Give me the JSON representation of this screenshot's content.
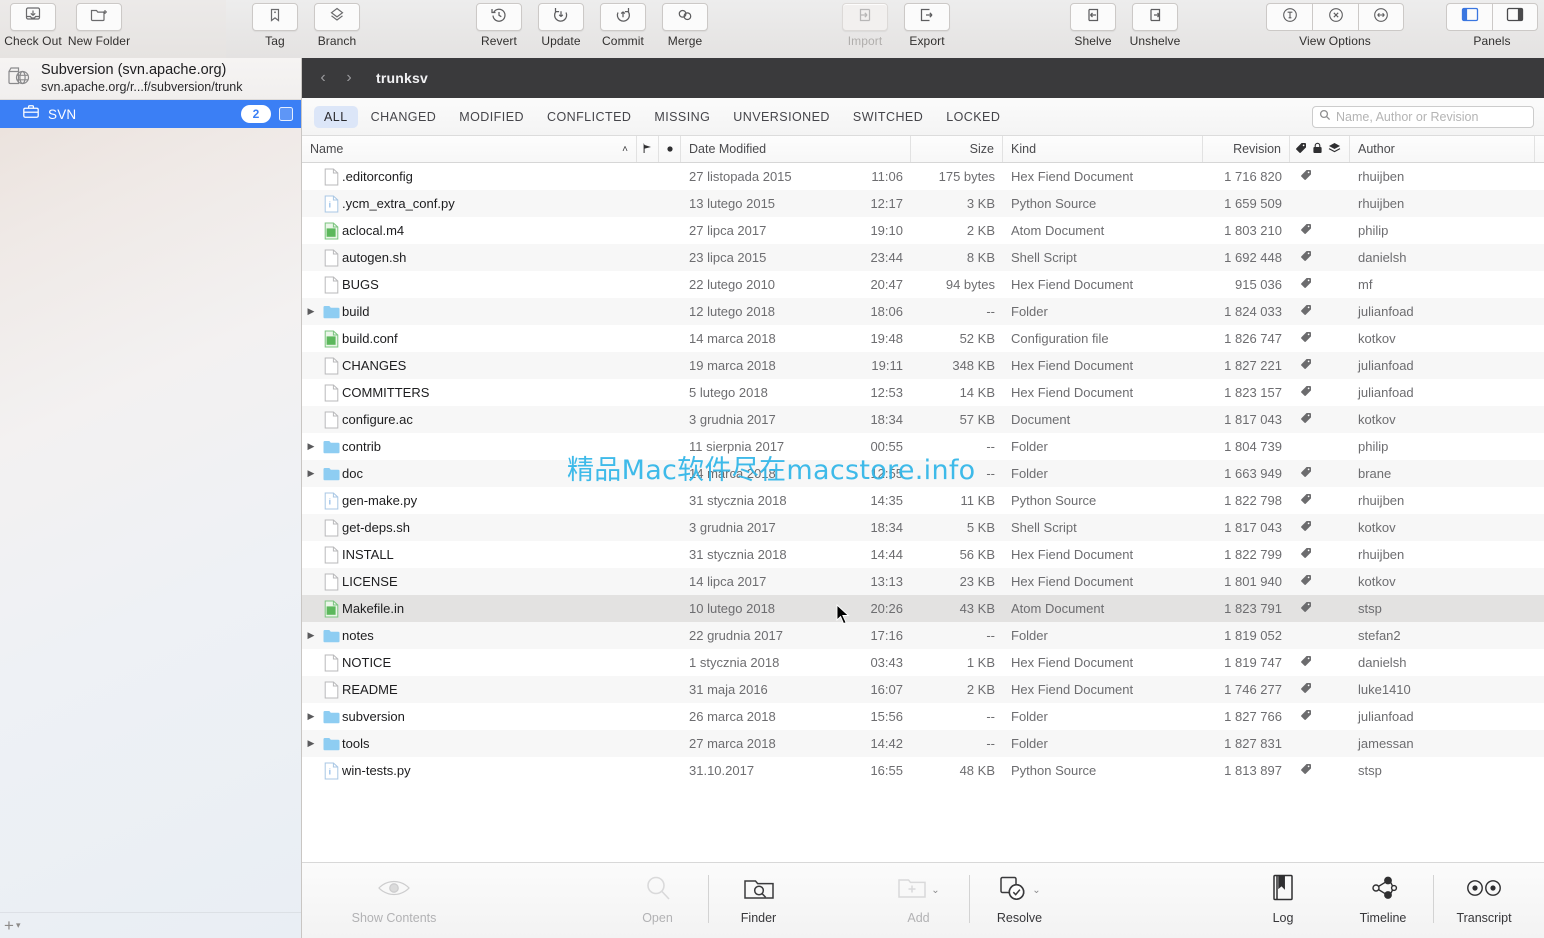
{
  "toolbar": {
    "left_items": [
      {
        "label": "Check Out",
        "icon": "check-out-icon",
        "enabled": true
      },
      {
        "label": "New Folder",
        "icon": "new-folder-icon",
        "enabled": true
      }
    ],
    "tag_branch": [
      {
        "label": "Tag",
        "icon": "tag-icon",
        "enabled": true
      },
      {
        "label": "Branch",
        "icon": "branch-icon",
        "enabled": true
      }
    ],
    "actions": [
      {
        "label": "Revert",
        "icon": "revert-icon",
        "enabled": true
      },
      {
        "label": "Update",
        "icon": "update-icon",
        "enabled": true
      },
      {
        "label": "Commit",
        "icon": "commit-icon",
        "enabled": true
      },
      {
        "label": "Merge",
        "icon": "merge-icon",
        "enabled": true
      }
    ],
    "transfer": [
      {
        "label": "Import",
        "icon": "import-icon",
        "enabled": false
      },
      {
        "label": "Export",
        "icon": "export-icon",
        "enabled": true
      }
    ],
    "shelve": [
      {
        "label": "Shelve",
        "icon": "shelve-icon",
        "enabled": true
      },
      {
        "label": "Unshelve",
        "icon": "unshelve-icon",
        "enabled": true
      }
    ],
    "view_options": {
      "label": "View Options",
      "buttons": [
        "text-size-icon",
        "close-circle-icon",
        "resize-width-icon"
      ]
    },
    "panels": {
      "label": "Panels",
      "buttons": [
        "left-panel-icon",
        "right-panel-icon"
      ],
      "active_index": 0
    }
  },
  "sidebar": {
    "repository": {
      "title": "Subversion (svn.apache.org)",
      "url": "svn.apache.org/r...f/subversion/trunk",
      "icon": "repository-globe-icon"
    },
    "items": [
      {
        "label": "SVN",
        "badge": "2",
        "icon": "working-copy-icon",
        "selected": true,
        "checkbox": true
      }
    ],
    "add_button": {
      "icon": "plus-icon",
      "caret": "chevron-down-icon"
    }
  },
  "pathbar": {
    "back": "chevron-left-icon",
    "forward": "chevron-right-icon",
    "path": "trunksv"
  },
  "filters": {
    "tabs": [
      "ALL",
      "CHANGED",
      "MODIFIED",
      "CONFLICTED",
      "MISSING",
      "UNVERSIONED",
      "SWITCHED",
      "LOCKED"
    ],
    "active": "ALL"
  },
  "search": {
    "placeholder": "Name, Author or Revision",
    "value": "",
    "icon": "search-icon"
  },
  "table": {
    "columns": [
      {
        "key": "name",
        "label": "Name",
        "sort": "ascending",
        "sort_icon": "chevron-up-icon"
      },
      {
        "key": "flag",
        "label": "",
        "icon": "flag-icon"
      },
      {
        "key": "dot",
        "label": "",
        "icon": "dot-icon"
      },
      {
        "key": "date",
        "label": "Date Modified"
      },
      {
        "key": "size",
        "label": "Size"
      },
      {
        "key": "kind",
        "label": "Kind"
      },
      {
        "key": "rev",
        "label": "Revision"
      },
      {
        "key": "tag",
        "label": "",
        "icon": "tag-icon"
      },
      {
        "key": "lock",
        "label": "",
        "icon": "lock-icon"
      },
      {
        "key": "stack",
        "label": "",
        "icon": "layers-icon"
      },
      {
        "key": "author",
        "label": "Author"
      }
    ],
    "rows": [
      {
        "name": ".editorconfig",
        "icon": "file-blank-icon",
        "folder": false,
        "date": "27 listopada 2015",
        "time": "11:06",
        "size": "175 bytes",
        "kind": "Hex Fiend Document",
        "revision": "1 716 820",
        "tag": true,
        "author": "rhuijben"
      },
      {
        "name": ".ycm_extra_conf.py",
        "icon": "file-python-icon",
        "folder": false,
        "date": "13 lutego 2015",
        "time": "12:17",
        "size": "3 KB",
        "kind": "Python Source",
        "revision": "1 659 509",
        "tag": false,
        "author": "rhuijben"
      },
      {
        "name": "aclocal.m4",
        "icon": "file-atom-icon",
        "folder": false,
        "date": "27 lipca 2017",
        "time": "19:10",
        "size": "2 KB",
        "kind": "Atom Document",
        "revision": "1 803 210",
        "tag": true,
        "author": "philip"
      },
      {
        "name": "autogen.sh",
        "icon": "file-blank-icon",
        "folder": false,
        "date": "23 lipca 2015",
        "time": "23:44",
        "size": "8 KB",
        "kind": "Shell Script",
        "revision": "1 692 448",
        "tag": true,
        "author": "danielsh"
      },
      {
        "name": "BUGS",
        "icon": "file-blank-icon",
        "folder": false,
        "date": "22 lutego 2010",
        "time": "20:47",
        "size": "94 bytes",
        "kind": "Hex Fiend Document",
        "revision": "915 036",
        "tag": true,
        "author": "mf"
      },
      {
        "name": "build",
        "icon": "folder-icon",
        "folder": true,
        "date": "12 lutego 2018",
        "time": "18:06",
        "size": "--",
        "kind": "Folder",
        "revision": "1 824 033",
        "tag": true,
        "author": "julianfoad"
      },
      {
        "name": "build.conf",
        "icon": "file-atom-icon",
        "folder": false,
        "date": "14 marca 2018",
        "time": "19:48",
        "size": "52 KB",
        "kind": "Configuration file",
        "revision": "1 826 747",
        "tag": true,
        "author": "kotkov"
      },
      {
        "name": "CHANGES",
        "icon": "file-blank-icon",
        "folder": false,
        "date": "19 marca 2018",
        "time": "19:11",
        "size": "348 KB",
        "kind": "Hex Fiend Document",
        "revision": "1 827 221",
        "tag": true,
        "author": "julianfoad"
      },
      {
        "name": "COMMITTERS",
        "icon": "file-blank-icon",
        "folder": false,
        "date": "5 lutego 2018",
        "time": "12:53",
        "size": "14 KB",
        "kind": "Hex Fiend Document",
        "revision": "1 823 157",
        "tag": true,
        "author": "julianfoad"
      },
      {
        "name": "configure.ac",
        "icon": "file-blank-icon",
        "folder": false,
        "date": "3 grudnia 2017",
        "time": "18:34",
        "size": "57 KB",
        "kind": "Document",
        "revision": "1 817 043",
        "tag": true,
        "author": "kotkov"
      },
      {
        "name": "contrib",
        "icon": "folder-icon",
        "folder": true,
        "date": "11 sierpnia 2017",
        "time": "00:55",
        "size": "--",
        "kind": "Folder",
        "revision": "1 804 739",
        "tag": false,
        "author": "philip"
      },
      {
        "name": "doc",
        "icon": "folder-icon",
        "folder": true,
        "date": "14 marca 2018",
        "time": "12:55",
        "size": "--",
        "kind": "Folder",
        "revision": "1 663 949",
        "tag": true,
        "author": "brane"
      },
      {
        "name": "gen-make.py",
        "icon": "file-python-icon",
        "folder": false,
        "date": "31 stycznia 2018",
        "time": "14:35",
        "size": "11 KB",
        "kind": "Python Source",
        "revision": "1 822 798",
        "tag": true,
        "author": "rhuijben"
      },
      {
        "name": "get-deps.sh",
        "icon": "file-blank-icon",
        "folder": false,
        "date": "3 grudnia 2017",
        "time": "18:34",
        "size": "5 KB",
        "kind": "Shell Script",
        "revision": "1 817 043",
        "tag": true,
        "author": "kotkov"
      },
      {
        "name": "INSTALL",
        "icon": "file-blank-icon",
        "folder": false,
        "date": "31 stycznia 2018",
        "time": "14:44",
        "size": "56 KB",
        "kind": "Hex Fiend Document",
        "revision": "1 822 799",
        "tag": true,
        "author": "rhuijben"
      },
      {
        "name": "LICENSE",
        "icon": "file-blank-icon",
        "folder": false,
        "date": "14 lipca 2017",
        "time": "13:13",
        "size": "23 KB",
        "kind": "Hex Fiend Document",
        "revision": "1 801 940",
        "tag": true,
        "author": "kotkov"
      },
      {
        "name": "Makefile.in",
        "icon": "file-atom-icon",
        "folder": false,
        "date": "10 lutego 2018",
        "time": "20:26",
        "size": "43 KB",
        "kind": "Atom Document",
        "revision": "1 823 791",
        "tag": true,
        "author": "stsp",
        "highlighted": true
      },
      {
        "name": "notes",
        "icon": "folder-icon",
        "folder": true,
        "date": "22 grudnia 2017",
        "time": "17:16",
        "size": "--",
        "kind": "Folder",
        "revision": "1 819 052",
        "tag": false,
        "author": "stefan2"
      },
      {
        "name": "NOTICE",
        "icon": "file-blank-icon",
        "folder": false,
        "date": "1 stycznia 2018",
        "time": "03:43",
        "size": "1 KB",
        "kind": "Hex Fiend Document",
        "revision": "1 819 747",
        "tag": true,
        "author": "danielsh"
      },
      {
        "name": "README",
        "icon": "file-blank-icon",
        "folder": false,
        "date": "31 maja 2016",
        "time": "16:07",
        "size": "2 KB",
        "kind": "Hex Fiend Document",
        "revision": "1 746 277",
        "tag": true,
        "author": "luke1410"
      },
      {
        "name": "subversion",
        "icon": "folder-icon",
        "folder": true,
        "date": "26 marca 2018",
        "time": "15:56",
        "size": "--",
        "kind": "Folder",
        "revision": "1 827 766",
        "tag": true,
        "author": "julianfoad"
      },
      {
        "name": "tools",
        "icon": "folder-icon",
        "folder": true,
        "date": "27 marca 2018",
        "time": "14:42",
        "size": "--",
        "kind": "Folder",
        "revision": "1 827 831",
        "tag": false,
        "author": "jamessan"
      },
      {
        "name": "win-tests.py",
        "icon": "file-python-icon",
        "folder": false,
        "date": "31.10.2017",
        "time": "16:55",
        "size": "48 KB",
        "kind": "Python Source",
        "revision": "1 813 897",
        "tag": true,
        "author": "stsp"
      }
    ]
  },
  "bottombar": {
    "items": [
      {
        "label": "Show Contents",
        "icon": "eye-icon",
        "enabled": false,
        "caret": false
      },
      {
        "label": "Open",
        "icon": "magnifier-icon",
        "enabled": false,
        "caret": false
      },
      {
        "label": "Finder",
        "icon": "finder-icon",
        "enabled": true,
        "caret": false
      },
      {
        "label": "Add",
        "icon": "add-folder-icon",
        "enabled": false,
        "caret": true
      },
      {
        "label": "Resolve",
        "icon": "resolve-icon",
        "enabled": true,
        "caret": true
      },
      {
        "label": "Log",
        "icon": "log-book-icon",
        "enabled": true,
        "caret": false
      },
      {
        "label": "Timeline",
        "icon": "timeline-icon",
        "enabled": true,
        "caret": false
      },
      {
        "label": "Transcript",
        "icon": "transcript-icon",
        "enabled": true,
        "caret": false
      }
    ]
  },
  "watermark": {
    "text": "精品Mac软件尽在macstore.info",
    "color": "#2fb5e8"
  },
  "colors": {
    "accent": "#3b7ff5",
    "filter_active_bg": "#dce6f8",
    "pathbar_bg": "#3a3a3c",
    "folder_icon": "#8ecdf2"
  }
}
